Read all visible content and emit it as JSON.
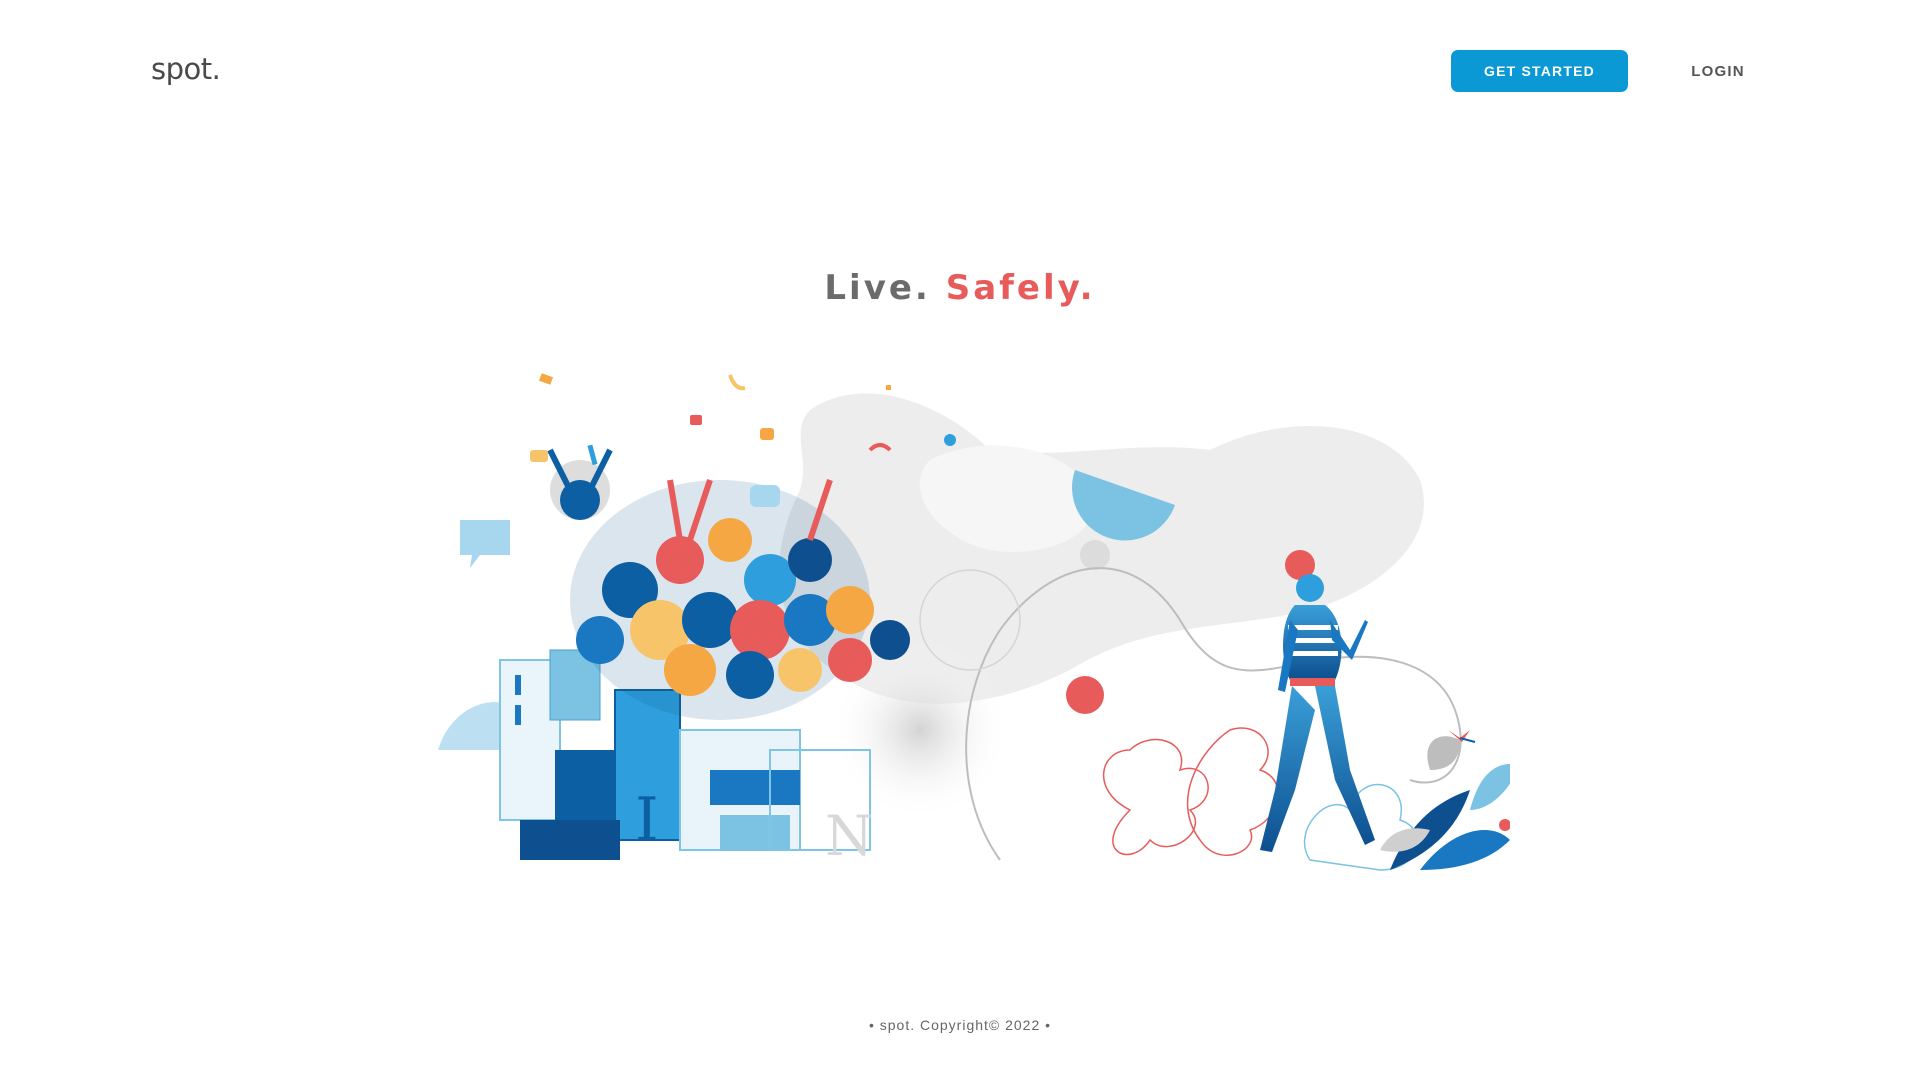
{
  "header": {
    "logo": "spot.",
    "get_started_label": "GET STARTED",
    "login_label": "LOGIN"
  },
  "hero": {
    "word1": "Live.",
    "word2": "Safely."
  },
  "footer": {
    "copyright": "• spot. Copyright© 2022 •"
  },
  "colors": {
    "primary": "#0a99d4",
    "accent": "#e85b5b",
    "text": "#6b6b6b"
  }
}
